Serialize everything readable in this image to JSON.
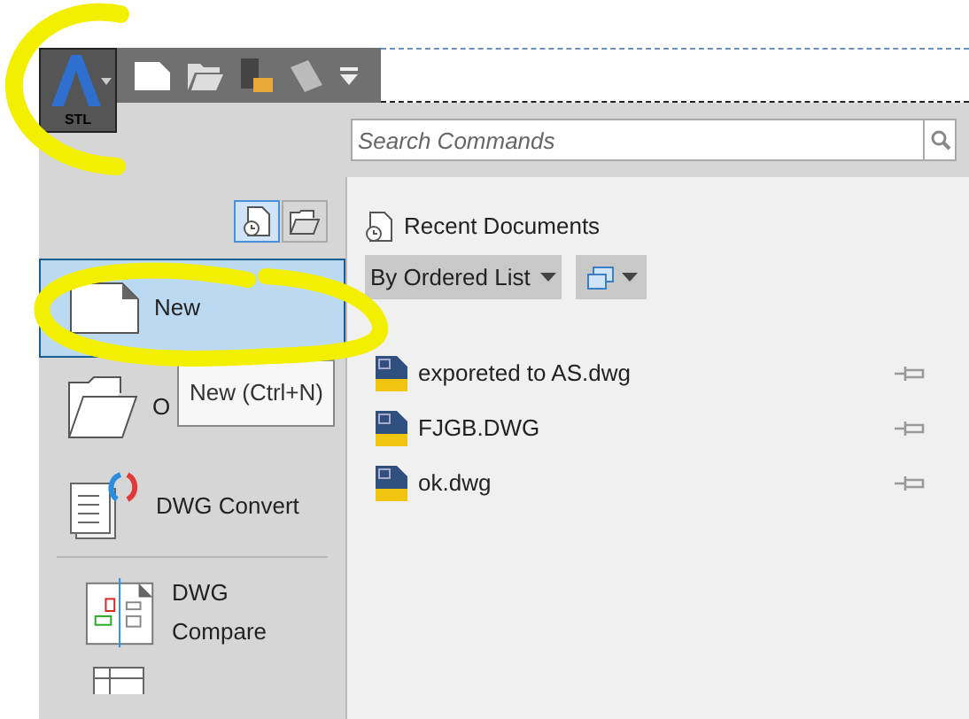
{
  "app_button": {
    "label": "STL"
  },
  "search": {
    "placeholder": "Search Commands"
  },
  "view_toggles": [
    {
      "kind": "recent",
      "selected": true
    },
    {
      "kind": "open",
      "selected": false
    }
  ],
  "menu": [
    {
      "kind": "new",
      "label": "New",
      "selected": true
    },
    {
      "kind": "open",
      "label": "O",
      "selected": false
    },
    {
      "kind": "convert",
      "label": "DWG Convert",
      "selected": false
    },
    {
      "kind": "compare",
      "label": "DWG Compare",
      "selected": false
    },
    {
      "kind": "more",
      "selected": false
    }
  ],
  "tooltip": "New (Ctrl+N)",
  "recent": {
    "title": "Recent Documents",
    "sort": "By Ordered List",
    "files": [
      {
        "name": "exporeted to AS.dwg"
      },
      {
        "name": "FJGB.DWG"
      },
      {
        "name": "ok.dwg"
      }
    ]
  }
}
